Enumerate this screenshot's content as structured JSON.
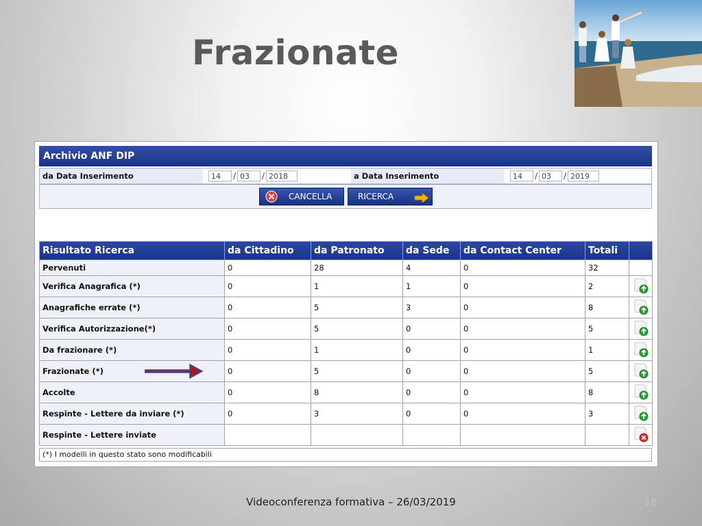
{
  "slide": {
    "title": "Frazionate",
    "footer": "Videoconferenza formativa – 26/03/2019",
    "page_number": "18"
  },
  "panel": {
    "title": "Archivio ANF DIP",
    "from_label": "da Data Inserimento",
    "from_day": "14",
    "from_month": "03",
    "from_year": "2018",
    "to_label": "a Data Inserimento",
    "to_day": "14",
    "to_month": "03",
    "to_year": "2019",
    "cancel_label": "CANCELLA",
    "search_label": "RICERCA"
  },
  "results": {
    "headers": [
      "Risultato Ricerca",
      "da Cittadino",
      "da Patronato",
      "da Sede",
      "da Contact Center",
      "Totali"
    ],
    "rows": [
      {
        "label": "Pervenuti",
        "values": [
          "0",
          "28",
          "4",
          "0",
          "32"
        ],
        "action": "none"
      },
      {
        "label": "Verifica Anagrafica (*)",
        "values": [
          "0",
          "1",
          "1",
          "0",
          "2"
        ],
        "action": "open"
      },
      {
        "label": "Anagrafiche errate (*)",
        "values": [
          "0",
          "5",
          "3",
          "0",
          "8"
        ],
        "action": "open"
      },
      {
        "label": "Verifica Autorizzazione(*)",
        "values": [
          "0",
          "5",
          "0",
          "0",
          "5"
        ],
        "action": "open"
      },
      {
        "label": "Da frazionare (*)",
        "values": [
          "0",
          "1",
          "0",
          "0",
          "1"
        ],
        "action": "open"
      },
      {
        "label": "Frazionate (*)",
        "values": [
          "0",
          "5",
          "0",
          "0",
          "5"
        ],
        "action": "open"
      },
      {
        "label": "Accolte",
        "values": [
          "0",
          "8",
          "0",
          "0",
          "8"
        ],
        "action": "open"
      },
      {
        "label": "Respinte - Lettere da inviare (*)",
        "values": [
          "0",
          "3",
          "0",
          "0",
          "3"
        ],
        "action": "open"
      },
      {
        "label": "Respinte - Lettere inviate",
        "values": [
          "",
          "",
          "",
          "",
          ""
        ],
        "action": "cancel"
      }
    ],
    "note": "(*) I modelli in questo stato sono modificabili"
  }
}
